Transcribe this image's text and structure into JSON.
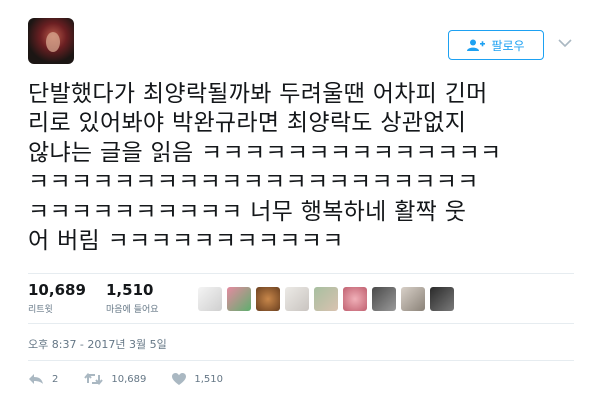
{
  "header": {
    "follow_label": "팔로우",
    "accent_color": "#1da1f2"
  },
  "tweet": {
    "lines": [
      "단발했다가 최양락될까봐 두려울땐 어차피 긴머",
      "리로 있어봐야 박완규라면 최양락도 상관없지",
      "않냐는 글을 읽음 ㅋㅋㅋㅋㅋㅋㅋㅋㅋㅋㅋㅋㅋㅋ",
      "ㅋㅋㅋㅋㅋㅋㅋㅋㅋㅋㅋㅋㅋㅋㅋㅋㅋㅋㅋㅋㅋ",
      "ㅋㅋㅋㅋㅋㅋㅋㅋㅋㅋ 너무 행복하네 활짝 웃",
      "어 버림 ㅋㅋㅋㅋㅋㅋㅋㅋㅋㅋㅋ"
    ]
  },
  "stats": {
    "retweets_count": "10,689",
    "retweets_label": "리트윗",
    "likes_count": "1,510",
    "likes_label": "마음에 들어요"
  },
  "timestamp": "오후 8:37 - 2017년 3월 5일",
  "actions": {
    "reply_count": "2",
    "retweet_count": "10,689",
    "like_count": "1,510"
  },
  "icons": {
    "follow": "add-person-icon",
    "caret": "chevron-down-icon",
    "reply": "reply-icon",
    "retweet": "retweet-icon",
    "like": "heart-icon"
  }
}
